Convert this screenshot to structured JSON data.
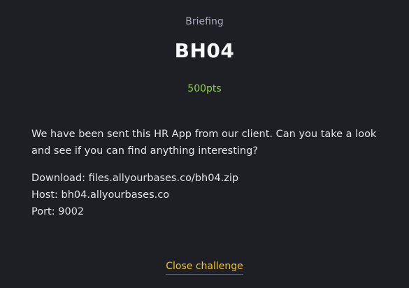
{
  "modal": {
    "kicker": "Briefing",
    "title": "BH04",
    "points": "500pts",
    "description": "We have been sent this HR App from our client. Can you take a look and see if you can find anything interesting?",
    "download": "Download: files.allyourbases.co/bh04.zip",
    "host": "Host: bh04.allyourbases.co",
    "port": "Port: 9002",
    "close_label": "Close challenge"
  },
  "colors": {
    "background": "#1e1f24",
    "points": "#8fd14b",
    "close_link": "#f0c23a"
  }
}
